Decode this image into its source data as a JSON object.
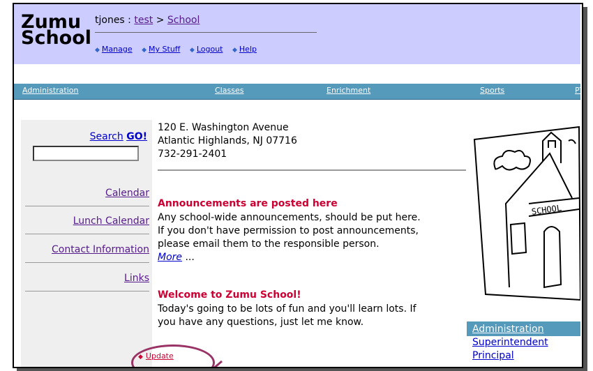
{
  "logo": {
    "line1": "Zumu",
    "line2": "School"
  },
  "breadcrumb": {
    "user": "tjones",
    "sep1": " : ",
    "site": "test",
    "sep2": " > ",
    "page": "School"
  },
  "topnav": [
    "Manage",
    "My Stuff",
    "Logout",
    "Help"
  ],
  "tabs": [
    "Administration",
    "Classes",
    "Enrichment",
    "Sports",
    "PT"
  ],
  "sidebar": {
    "search_label": "Search",
    "search_go": "GO!",
    "links": [
      "Calendar",
      "Lunch Calendar",
      "Contact Information",
      "Links"
    ]
  },
  "address": [
    "120 E. Washington Avenue",
    "Atlantic Highlands, NJ 07716",
    "732-291-2401"
  ],
  "announcements": [
    {
      "title": "Announcements are posted here",
      "body": [
        "Any school-wide announcements, should be put here.",
        "If you don't have permission to post announcements,",
        "please email them to the responsible person."
      ],
      "more": "More",
      "more_suffix": " ..."
    },
    {
      "title": "Welcome to Zumu School!",
      "body": [
        "Today's going to be lots of fun and you'll learn lots. If",
        "you have any questions, just let me know."
      ]
    }
  ],
  "update_label": "Update",
  "illustration_text": "SCHOOL",
  "admin_panel": {
    "header": "Administration",
    "items": [
      "Superintendent",
      "Principal"
    ]
  },
  "colors": {
    "header_bg": "#ccccff",
    "tab_bar": "#5599bb",
    "announce_title": "#cc0033",
    "highlight_oval": "#993366"
  }
}
